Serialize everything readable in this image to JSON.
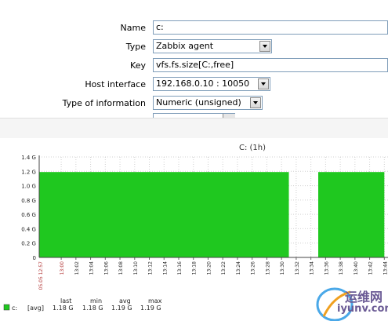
{
  "form": {
    "name": {
      "label": "Name",
      "value": "c:"
    },
    "type": {
      "label": "Type",
      "value": "Zabbix agent"
    },
    "key": {
      "label": "Key",
      "value": "vfs.fs.size[C:,free]"
    },
    "host_interface": {
      "label": "Host interface",
      "value": "192.168.0.10 : 10050"
    },
    "type_of_information": {
      "label": "Type of information",
      "value": "Numeric (unsigned)"
    }
  },
  "chart_data": {
    "type": "area",
    "title": "C: (1h)",
    "y_ticks": [
      "0",
      "0.2 G",
      "0.4 G",
      "0.6 G",
      "0.8 G",
      "1.0 G",
      "1.2 G",
      "1.4 G"
    ],
    "x_start_label": "05.05 12:57",
    "x_ticks": [
      "13:00",
      "13:02",
      "13:04",
      "13:06",
      "13:08",
      "13:10",
      "13:12",
      "13:14",
      "13:16",
      "13:18",
      "13:20",
      "13:22",
      "13:24",
      "13:26",
      "13:28",
      "13:30",
      "13:32",
      "13:34",
      "13:36",
      "13:38",
      "13:40",
      "13:42",
      "13:44"
    ],
    "ylim": [
      0,
      1.4
    ],
    "y_unit": "G",
    "series": [
      {
        "name": "c:",
        "color": "#1fc81f",
        "segments": [
          {
            "from": "12:57",
            "to": "13:31",
            "value": 1.19
          },
          {
            "from": "13:35",
            "to": "13:44",
            "value": 1.19
          }
        ]
      }
    ],
    "grid": true,
    "legend": {
      "headers": [
        "last",
        "min",
        "avg",
        "max"
      ],
      "rows": [
        {
          "name": "c:",
          "func": "[avg]",
          "last": "1.18 G",
          "min": "1.18 G",
          "avg": "1.19 G",
          "max": "1.19 G"
        }
      ]
    }
  },
  "watermark": {
    "cn": "运维网",
    "url": "iyunv.com"
  }
}
